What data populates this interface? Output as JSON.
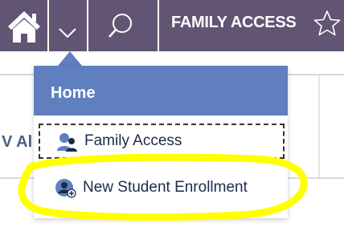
{
  "topbar": {
    "home_icon": "home-icon",
    "menu_icon": "chevron-down-icon",
    "search_icon": "search-icon",
    "title": "FAMILY ACCESS",
    "star_icon": "star-icon",
    "bar_color": "#625573"
  },
  "background": {
    "partial_text": "V Al"
  },
  "dropdown": {
    "header": "Home",
    "header_color": "#5f7fbf",
    "items": [
      {
        "label": "Family Access",
        "icon": "family-icon"
      },
      {
        "label": "New Student Enrollment",
        "icon": "user-add-icon"
      }
    ]
  },
  "annotation": {
    "highlight_color": "#ffff00"
  }
}
